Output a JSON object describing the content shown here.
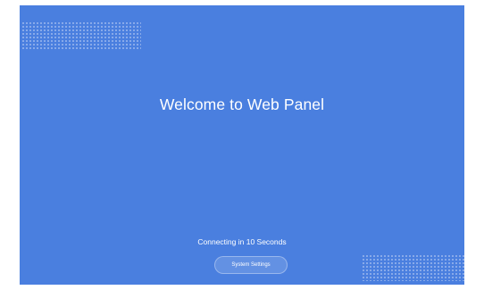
{
  "welcome": {
    "title": "Welcome to Web Panel"
  },
  "status": {
    "connecting_text": "Connecting in 10 Seconds"
  },
  "actions": {
    "system_settings_label": "System Settings"
  },
  "colors": {
    "background": "#4a7fdf",
    "text": "#ffffff"
  }
}
